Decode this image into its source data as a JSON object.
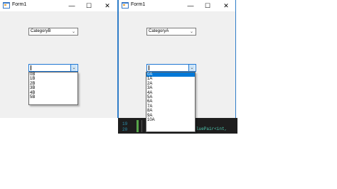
{
  "left_window": {
    "title": "Form1",
    "combo_top": {
      "value": "CategoryB"
    },
    "combo_bottom": {
      "value": ""
    },
    "dropdown": {
      "items": [
        "0B",
        "1B",
        "2B",
        "3B",
        "4B",
        "5B"
      ]
    }
  },
  "right_window": {
    "title": "Form1",
    "combo_top": {
      "value": "CategoryA"
    },
    "combo_bottom": {
      "value": ""
    },
    "dropdown": {
      "items": [
        "0A",
        "1A",
        "2A",
        "3A",
        "4A",
        "5A",
        "6A",
        "7A",
        "8A",
        "9A",
        "10A"
      ],
      "selected_index": 0
    }
  },
  "editor": {
    "line_numbers": [
      "19",
      "20"
    ],
    "code_fragment": "luePair<int,"
  },
  "icons": {
    "minimize": "minimize-icon",
    "maximize": "maximize-icon",
    "close": "close-icon",
    "dropdown_arrow": "chevron-down-icon"
  },
  "glyphs": {
    "minimize": "—",
    "maximize": "☐",
    "close": "✕",
    "arrow": "⌄"
  }
}
